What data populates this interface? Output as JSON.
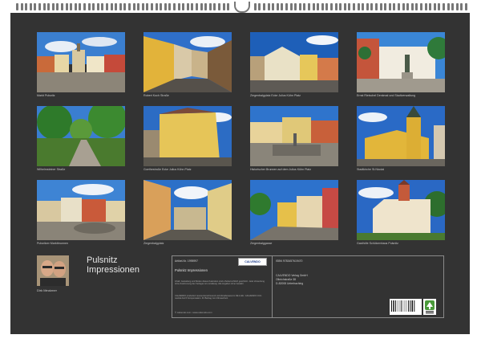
{
  "photos": [
    {
      "caption": "Markt Pulsnitz"
    },
    {
      "caption": "Robert Koch Straße"
    },
    {
      "caption": "Ziegenbalgplatz Ecke Julius Kühn Platz"
    },
    {
      "caption": "Ernst Rietschel Denkmal und Stadtverwaltung"
    },
    {
      "caption": "Wilhelmsteiner Straße"
    },
    {
      "caption": "Goethestraße Ecke Julius Kühn Platz"
    },
    {
      "caption": "Historischer Brunnen auf dem Julius Kühn Platz"
    },
    {
      "caption": "Stadtkirche St.Nicolai"
    },
    {
      "caption": "Pulsnitzer Marktbrunnen"
    },
    {
      "caption": "Ziegenbalgplatz"
    },
    {
      "caption": "Ziegenbalggasse"
    },
    {
      "caption": "Gasthöfe Schützenhaus Pulsnitz"
    }
  ],
  "author": {
    "name": "Dirk Meutzner"
  },
  "calendar": {
    "title_line1": "Pulsnitz",
    "title_line2": "Impressionen"
  },
  "info": {
    "article_no": "Artikel-Nr. 1995997",
    "isbn": "ISBN 9783457619470",
    "product_title": "Pulsnitz Impressionen",
    "legal_text": "Inhalt, Gestaltung und Motive dieses Kalenders sind urheberrechtlich geschützt. Jede Verwertung ohne Zustimmung des Verlages ist unzulässig. Alle Angaben ohne Gewähr.",
    "eco_text": "CALVENDO produziert ressourcenschonend und klimabewusst in DE & EU. CALVENDO CO2-neutral durch Kompensation. Ihr Beitrag zum Klimaschutz.",
    "website": "© calvendo.com • www.calvendo.com",
    "publisher_name": "CALVENDO Verlag GmbH",
    "publisher_street": "Olbrichstraße 38",
    "publisher_city": "D-82008 Unterhaching",
    "logo_text": "CALVENDO"
  },
  "colors": {
    "sheet": "#333333",
    "caption": "#c8c8c8",
    "title": "#e6e6e6"
  }
}
